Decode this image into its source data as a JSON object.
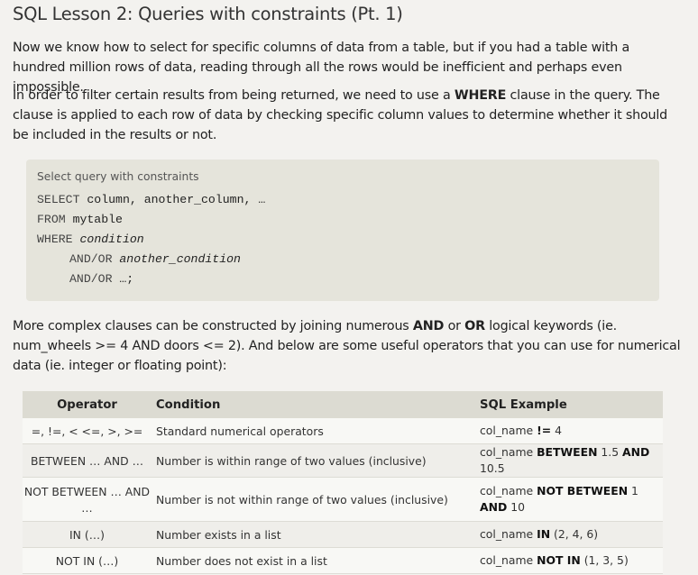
{
  "title": "SQL Lesson 2: Queries with constraints (Pt. 1)",
  "intro": "Now we know how to select for specific columns of data from a table, but if you had a table with a hundred million rows of data, reading through all the rows would be inefficient and perhaps even impossible.",
  "filter_para": {
    "before": "In order to filter certain results from being returned, we need to use a ",
    "keyword": "WHERE",
    "after": " clause in the query. The clause is applied to each row of data by checking specific column values to determine whether it should be included in the results or not."
  },
  "code": {
    "caption": "Select query with constraints",
    "lines": [
      {
        "kw": "SELECT",
        "rest": " column, another_column, …",
        "italic": false,
        "indent": 0
      },
      {
        "kw": "FROM",
        "rest": " mytable",
        "italic": false,
        "indent": 0
      },
      {
        "kw": "WHERE",
        "rest": " condition",
        "italic": true,
        "indent": 0
      },
      {
        "kw": "AND/OR",
        "rest": " another_condition",
        "italic": true,
        "indent": 1
      },
      {
        "kw": "AND/OR",
        "rest": " …;",
        "italic": false,
        "indent": 1
      }
    ]
  },
  "complex_para": {
    "t1": "More complex clauses can be constructed by joining numerous ",
    "k1": "AND",
    "t2": " or ",
    "k2": "OR",
    "t3": " logical keywords (ie. num_wheels >= 4 AND doors <= 2). And below are some useful operators that you can use for numerical data (ie. integer or floating point):"
  },
  "table": {
    "headers": [
      "Operator",
      "Condition",
      "SQL Example"
    ],
    "rows": [
      {
        "operator": "=, !=, < <=, >, >=",
        "condition": "Standard numerical operators",
        "example": [
          {
            "t": "col_name "
          },
          {
            "t": "!=",
            "b": true
          },
          {
            "t": " 4"
          }
        ]
      },
      {
        "operator": "BETWEEN … AND …",
        "condition": "Number is within range of two values (inclusive)",
        "example": [
          {
            "t": "col_name "
          },
          {
            "t": "BETWEEN",
            "b": true
          },
          {
            "t": " 1.5 "
          },
          {
            "t": "AND",
            "b": true
          },
          {
            "t": " 10.5"
          }
        ]
      },
      {
        "operator": "NOT BETWEEN … AND …",
        "condition": "Number is not within range of two values (inclusive)",
        "example": [
          {
            "t": "col_name "
          },
          {
            "t": "NOT BETWEEN",
            "b": true
          },
          {
            "t": " 1 "
          },
          {
            "t": "AND",
            "b": true
          },
          {
            "t": " 10"
          }
        ]
      },
      {
        "operator": "IN (…)",
        "condition": "Number exists in a list",
        "example": [
          {
            "t": "col_name "
          },
          {
            "t": "IN",
            "b": true
          },
          {
            "t": " (2, 4, 6)"
          }
        ]
      },
      {
        "operator": "NOT IN (…)",
        "condition": "Number does not exist in a list",
        "example": [
          {
            "t": "col_name "
          },
          {
            "t": "NOT IN",
            "b": true
          },
          {
            "t": " (1, 3, 5)"
          }
        ]
      }
    ]
  }
}
